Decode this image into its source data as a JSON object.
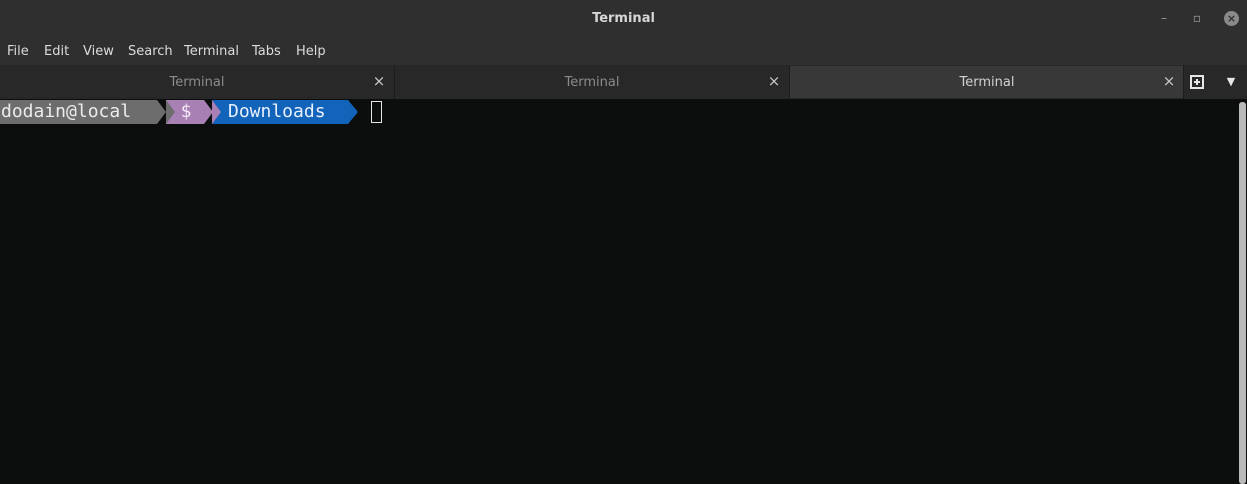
{
  "window": {
    "title": "Terminal",
    "controls": {
      "minimize": "–",
      "maximize": "▫",
      "close": "×"
    }
  },
  "menubar": {
    "items": [
      "File",
      "Edit",
      "View",
      "Search",
      "Terminal",
      "Tabs",
      "Help"
    ]
  },
  "tabs": [
    {
      "label": "Terminal",
      "active": false,
      "close": "×"
    },
    {
      "label": "Terminal",
      "active": false,
      "close": "×"
    },
    {
      "label": "Terminal",
      "active": true,
      "close": "×"
    }
  ],
  "tabbar": {
    "new_tab_icon": "new-tab-icon",
    "tabs_menu_icon": "▼"
  },
  "prompt": {
    "user_host": "dodain@local",
    "symbol": "$",
    "directory": "Downloads",
    "colors": {
      "user_bg": "#6d6d6d",
      "symbol_bg": "#a880b4",
      "directory_bg": "#1264bb"
    }
  }
}
